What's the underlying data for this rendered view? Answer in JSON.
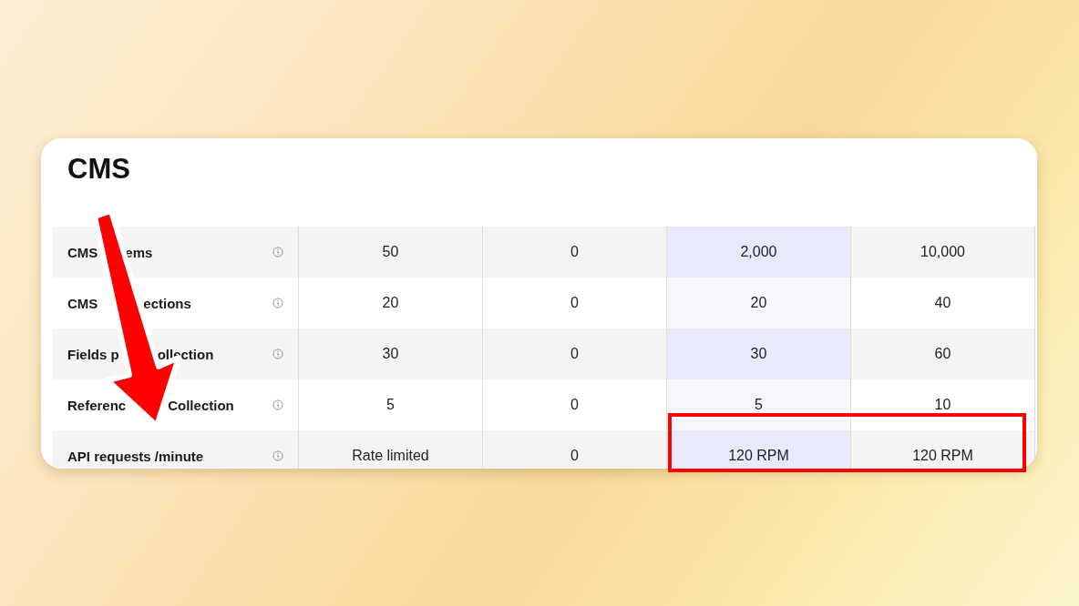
{
  "section": {
    "title": "CMS"
  },
  "columns": [
    {
      "highlighted": false
    },
    {
      "highlighted": false
    },
    {
      "highlighted": true
    },
    {
      "highlighted": false
    }
  ],
  "rows": [
    {
      "label_parts": [
        "CMS",
        "ems"
      ],
      "cells": [
        "50",
        "0",
        "2,000",
        "10,000"
      ]
    },
    {
      "label_parts": [
        "CMS",
        "ections"
      ],
      "cells": [
        "20",
        "0",
        "20",
        "40"
      ]
    },
    {
      "label_parts": [
        "Fields p",
        "ollection"
      ],
      "cells": [
        "30",
        "0",
        "30",
        "60"
      ]
    },
    {
      "label_parts": [
        "Referenc",
        "Collection"
      ],
      "cells": [
        "5",
        "0",
        "5",
        "10"
      ]
    },
    {
      "label_parts": [
        "API requests /minute"
      ],
      "cells": [
        "Rate limited",
        "0",
        "120 RPM",
        "120 RPM"
      ]
    }
  ],
  "annotations": {
    "arrow": true,
    "highlight_box": true
  }
}
